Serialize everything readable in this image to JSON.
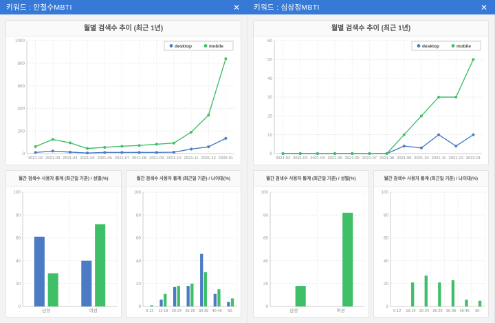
{
  "colors": {
    "header_bg": "#3779d6",
    "desktop": "#4a7bc4",
    "mobile": "#3fbf67"
  },
  "panels": [
    {
      "header": {
        "title": "키워드 : 안철수MBTI",
        "close_label": "✕"
      },
      "trend": {
        "type": "line",
        "title": "월별 검색수 추이 (최근 1년)",
        "x": [
          "2021-02",
          "2021-03",
          "2021-04",
          "2021-05",
          "2021-06",
          "2021-07",
          "2021-08",
          "2021-09",
          "2021-10",
          "2021-11",
          "2021-12",
          "2022-01"
        ],
        "ylim": [
          0,
          1000
        ],
        "yticks": [
          0,
          200,
          400,
          600,
          800,
          1000
        ],
        "legend": {
          "position": "top-right",
          "entries": [
            "desktop",
            "mobile"
          ]
        },
        "series": [
          {
            "name": "desktop",
            "color": "#4a7bc4",
            "values": [
              10,
              22,
              13,
              5,
              10,
              10,
              10,
              10,
              12,
              40,
              60,
              135
            ]
          },
          {
            "name": "mobile",
            "color": "#3fbf67",
            "values": [
              62,
              125,
              95,
              45,
              55,
              65,
              72,
              83,
              93,
              190,
              340,
              840
            ]
          }
        ]
      },
      "gender": {
        "type": "bar",
        "title": "월간 검색수 사용자 통계 (최근일 기준) / 성별(%)",
        "categories": [
          "남성",
          "여성"
        ],
        "ylim": [
          0,
          100
        ],
        "yticks": [
          0,
          20,
          40,
          60,
          80,
          100
        ],
        "series": [
          {
            "name": "desktop",
            "color": "#4a7bc4",
            "values": [
              61,
              40
            ]
          },
          {
            "name": "mobile",
            "color": "#3fbf67",
            "values": [
              29,
              72
            ]
          }
        ]
      },
      "age": {
        "type": "bar",
        "title": "월간 검색수 사용자 통계 (최근일 기준) / 나이대(%)",
        "categories": [
          "0-12",
          "13-19",
          "20-24",
          "25-29",
          "30-39",
          "40-49",
          "50-"
        ],
        "ylim": [
          0,
          100
        ],
        "yticks": [
          0,
          20,
          40,
          60,
          80,
          100
        ],
        "series": [
          {
            "name": "desktop",
            "color": "#4a7bc4",
            "values": [
              0,
              6,
              17,
              18,
              46,
              11,
              4
            ]
          },
          {
            "name": "mobile",
            "color": "#3fbf67",
            "values": [
              1,
              11,
              18,
              20,
              30,
              15,
              7
            ]
          }
        ]
      }
    },
    {
      "header": {
        "title": "키워드 : 심상정MBTI",
        "close_label": "✕"
      },
      "trend": {
        "type": "line",
        "title": "월별 검색수 추이 (최근 1년)",
        "x": [
          "2021-02",
          "2021-03",
          "2021-04",
          "2021-05",
          "2021-06",
          "2021-07",
          "2021-08",
          "2021-09",
          "2021-10",
          "2021-11",
          "2021-12",
          "2022-01"
        ],
        "ylim": [
          0,
          60
        ],
        "yticks": [
          0,
          10,
          20,
          30,
          40,
          50,
          60
        ],
        "legend": {
          "position": "top-right",
          "entries": [
            "desktop",
            "mobile"
          ]
        },
        "series": [
          {
            "name": "desktop",
            "color": "#4a7bc4",
            "values": [
              0,
              0,
              0,
              0,
              0,
              0,
              0,
              4,
              3,
              10,
              4,
              10
            ]
          },
          {
            "name": "mobile",
            "color": "#3fbf67",
            "values": [
              0,
              0,
              0,
              0,
              0,
              0,
              0,
              10,
              20,
              30,
              30,
              50
            ]
          }
        ]
      },
      "gender": {
        "type": "bar",
        "title": "월간 검색수 사용자 통계 (최근일 기준) / 성별(%)",
        "categories": [
          "남성",
          "여성"
        ],
        "ylim": [
          0,
          100
        ],
        "yticks": [
          0,
          20,
          40,
          60,
          80,
          100
        ],
        "series": [
          {
            "name": "desktop",
            "color": "#4a7bc4",
            "values": [
              0,
              0
            ]
          },
          {
            "name": "mobile",
            "color": "#3fbf67",
            "values": [
              18,
              82
            ]
          }
        ]
      },
      "age": {
        "type": "bar",
        "title": "월간 검색수 사용자 통계 (최근일 기준) / 나이대(%)",
        "categories": [
          "0-12",
          "13-19",
          "20-24",
          "25-29",
          "30-39",
          "40-49",
          "50-"
        ],
        "ylim": [
          0,
          100
        ],
        "yticks": [
          0,
          20,
          40,
          60,
          80,
          100
        ],
        "series": [
          {
            "name": "desktop",
            "color": "#4a7bc4",
            "values": [
              0,
              0,
              0,
              0,
              0,
              0,
              0
            ]
          },
          {
            "name": "mobile",
            "color": "#3fbf67",
            "values": [
              0,
              21,
              27,
              21,
              23,
              6,
              5
            ]
          }
        ]
      }
    }
  ]
}
